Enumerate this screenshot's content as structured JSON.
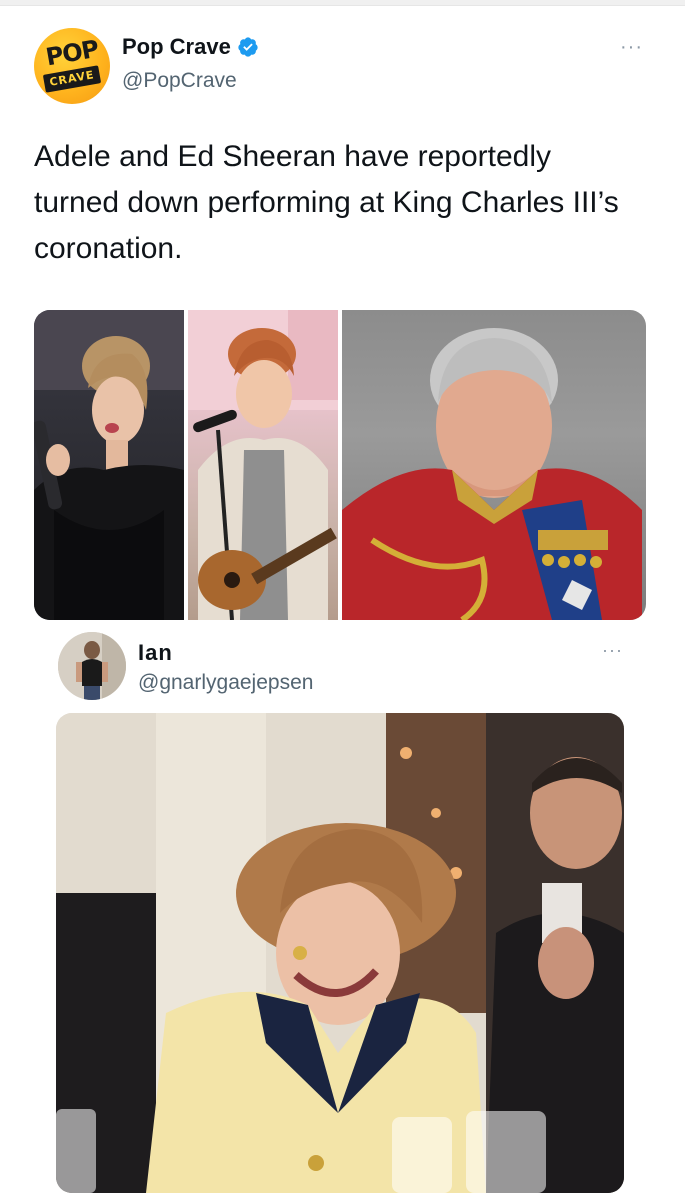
{
  "tweet": {
    "author_name": "Pop Crave",
    "author_handle": "@PopCrave",
    "avatar_text_top": "POP",
    "avatar_text_bottom": "CRAVE",
    "verified": true,
    "more_label": "···",
    "text": "Adele and Ed Sheeran have reportedly turned down performing at King Charles III’s coronation."
  },
  "quote": {
    "author_name": "Ian",
    "author_handle": "@gnarlygaejepsen",
    "more_label": "···"
  },
  "colors": {
    "verified_blue": "#1d9bf0",
    "secondary_text": "#536471",
    "popcrave_yellow": "#ffb41e"
  }
}
